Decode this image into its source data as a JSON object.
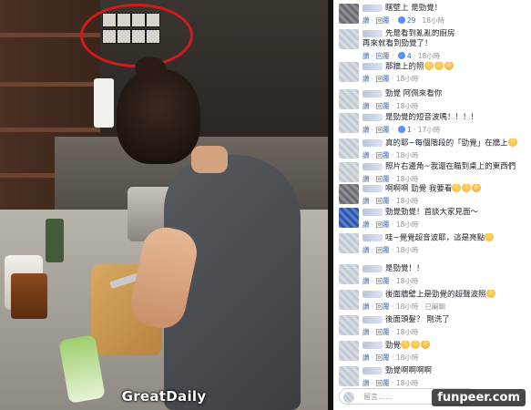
{
  "photo": {
    "watermark": "GreatDaily"
  },
  "comments": [
    {
      "lines": [
        "瞎壁上 是勁覺！"
      ],
      "meta": {
        "like": "讚",
        "reply": "回覆",
        "likes": "29",
        "time": "18小時"
      }
    },
    {
      "lines": [
        "先是看到亂亂的廚房",
        "再來就看到勁覺了！"
      ],
      "meta": {
        "like": "讚",
        "reply": "回覆",
        "likes": "4",
        "time": "18小時"
      }
    },
    {
      "lines": [
        "那牆上的照"
      ],
      "emoji": 3,
      "meta": {
        "like": "讚",
        "reply": "回覆",
        "likes": "",
        "time": "18小時"
      }
    },
    {
      "lines": [
        "勁覺 阿佩來看你"
      ],
      "meta": {
        "like": "讚",
        "reply": "回覆",
        "likes": "",
        "time": "18小時"
      }
    },
    {
      "lines": [
        "是勁覺的短音波嗎！！！！"
      ],
      "meta": {
        "like": "讚",
        "reply": "回覆",
        "likes": "1",
        "time": "17小時"
      }
    },
    {
      "lines": [
        "真的耶~每個階段的「勁覺」在牆上"
      ],
      "emoji": 1,
      "meta": {
        "like": "讚",
        "reply": "回覆",
        "likes": "",
        "time": "18小時"
      }
    },
    {
      "lines": [
        "照片右邊角~我還在瞄到桌上的東西們"
      ],
      "meta": {
        "like": "讚",
        "reply": "回覆",
        "likes": "",
        "time": "18小時"
      }
    },
    {
      "lines": [
        "啊啊啊 勁覺 我要看"
      ],
      "emoji": 3,
      "meta": {
        "like": "讚",
        "reply": "回覆",
        "likes": "",
        "time": "18小時"
      }
    },
    {
      "lines": [
        "勁覺勁覺！首談大家見面～"
      ],
      "meta": {
        "like": "讚",
        "reply": "回覆",
        "likes": "",
        "time": "18小時"
      }
    },
    {
      "lines": [
        "哇~覺覺超音波耶，這是亮點"
      ],
      "emoji": 1,
      "meta": {
        "like": "讚",
        "reply": "回覆",
        "likes": "",
        "time": "18小時"
      }
    },
    {
      "lines": [
        "是勁覺！！"
      ],
      "meta": {
        "like": "讚",
        "reply": "回覆",
        "likes": "",
        "time": "18小時"
      }
    },
    {
      "lines": [
        "後面牆壁上是勁覺的超聲波照"
      ],
      "emoji": 1,
      "meta": {
        "like": "讚",
        "reply": "回覆",
        "likes": "",
        "time": "18小時 · 已編輯"
      }
    },
    {
      "lines": [
        "後面頭髮？ 剛洗了"
      ],
      "meta": {
        "like": "讚",
        "reply": "回覆",
        "likes": "",
        "time": "18小時"
      }
    },
    {
      "lines": [
        "勁覺"
      ],
      "emoji": 3,
      "meta": {
        "like": "讚",
        "reply": "回覆",
        "likes": "",
        "time": "18小時"
      }
    },
    {
      "lines": [
        "勁覺啊啊啊啊"
      ],
      "meta": {
        "like": "讚",
        "reply": "回覆",
        "likes": "",
        "time": "18小時"
      }
    }
  ],
  "reply_placeholder": "留言……",
  "watermark_right": "funpeer.com"
}
